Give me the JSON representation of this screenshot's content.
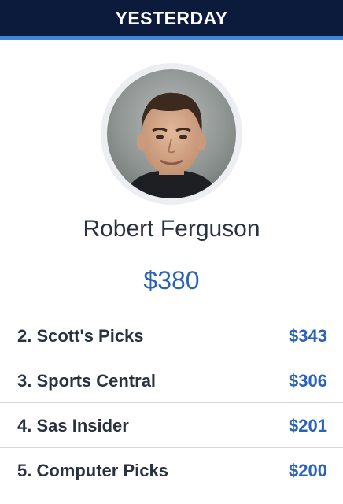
{
  "header": {
    "title": "YESTERDAY"
  },
  "colors": {
    "header_bg": "#0c1b3b",
    "accent_stripe": "#3f86d8",
    "money_blue": "#2a63b8",
    "text_dark": "#2a3240",
    "divider": "#d8d8d8"
  },
  "winner": {
    "avatar_icon": "person-photo-avatar",
    "name": "Robert Ferguson",
    "amount": "$380"
  },
  "leaderboard": [
    {
      "label": "2. Scott's Picks",
      "value": "$343"
    },
    {
      "label": "3. Sports Central",
      "value": "$306"
    },
    {
      "label": "4. Sas Insider",
      "value": "$201"
    },
    {
      "label": "5. Computer Picks",
      "value": "$200"
    }
  ]
}
